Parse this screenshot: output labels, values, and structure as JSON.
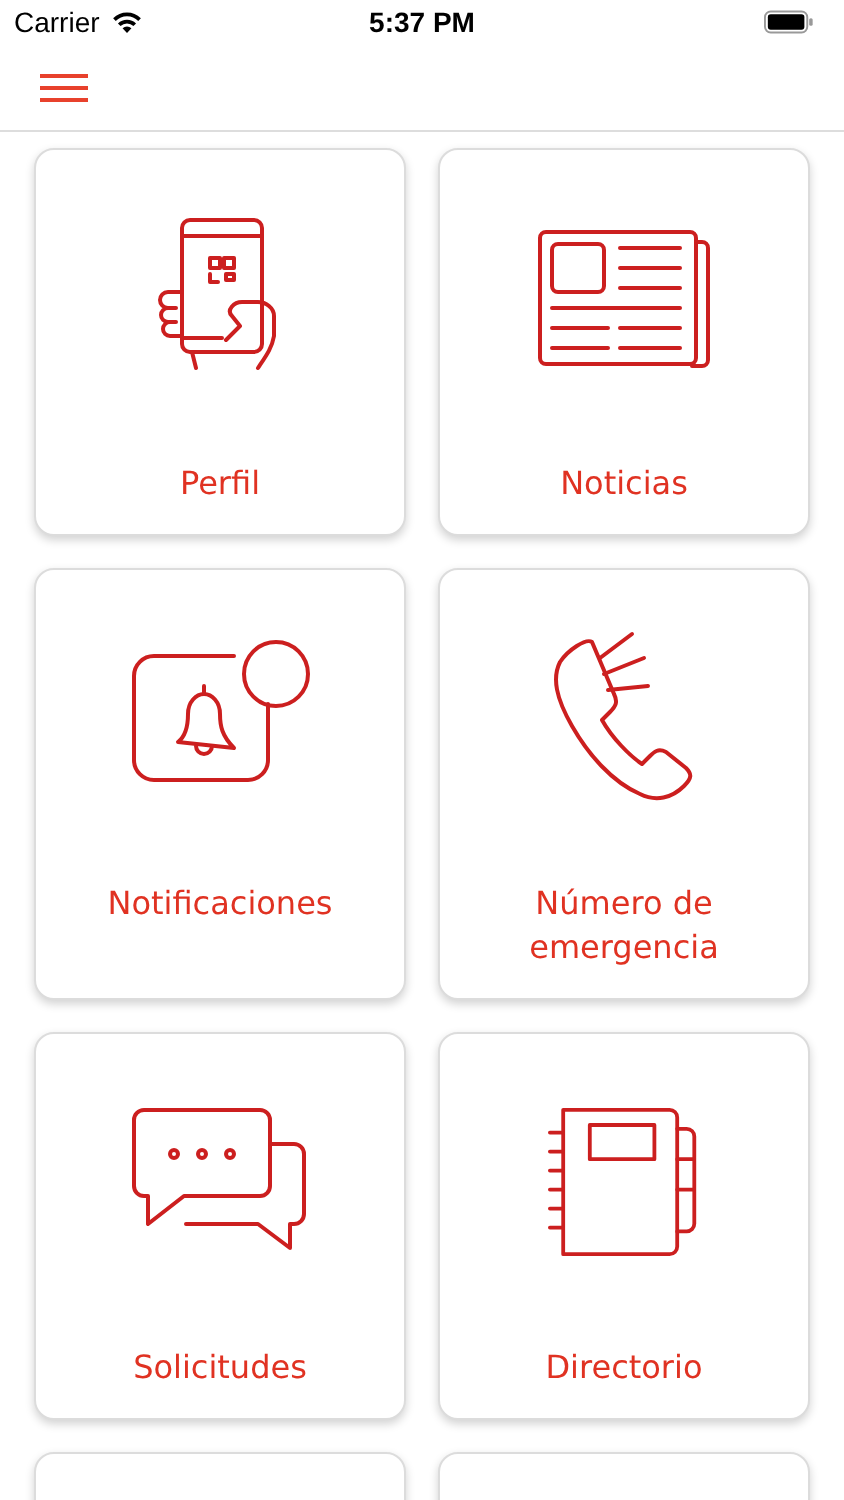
{
  "status_bar": {
    "carrier": "Carrier",
    "time": "5:37 PM"
  },
  "tiles": [
    {
      "kind": "tile",
      "label": "Perfil"
    },
    {
      "kind": "tile",
      "label": "Noticias"
    },
    {
      "kind": "tile",
      "label": "Notificaciones"
    },
    {
      "kind": "tile",
      "label": "Número de emergencia"
    },
    {
      "kind": "tile",
      "label": "Solicitudes"
    },
    {
      "kind": "tile",
      "label": "Directorio"
    },
    {
      "kind": "cut"
    },
    {
      "kind": "cut"
    }
  ]
}
